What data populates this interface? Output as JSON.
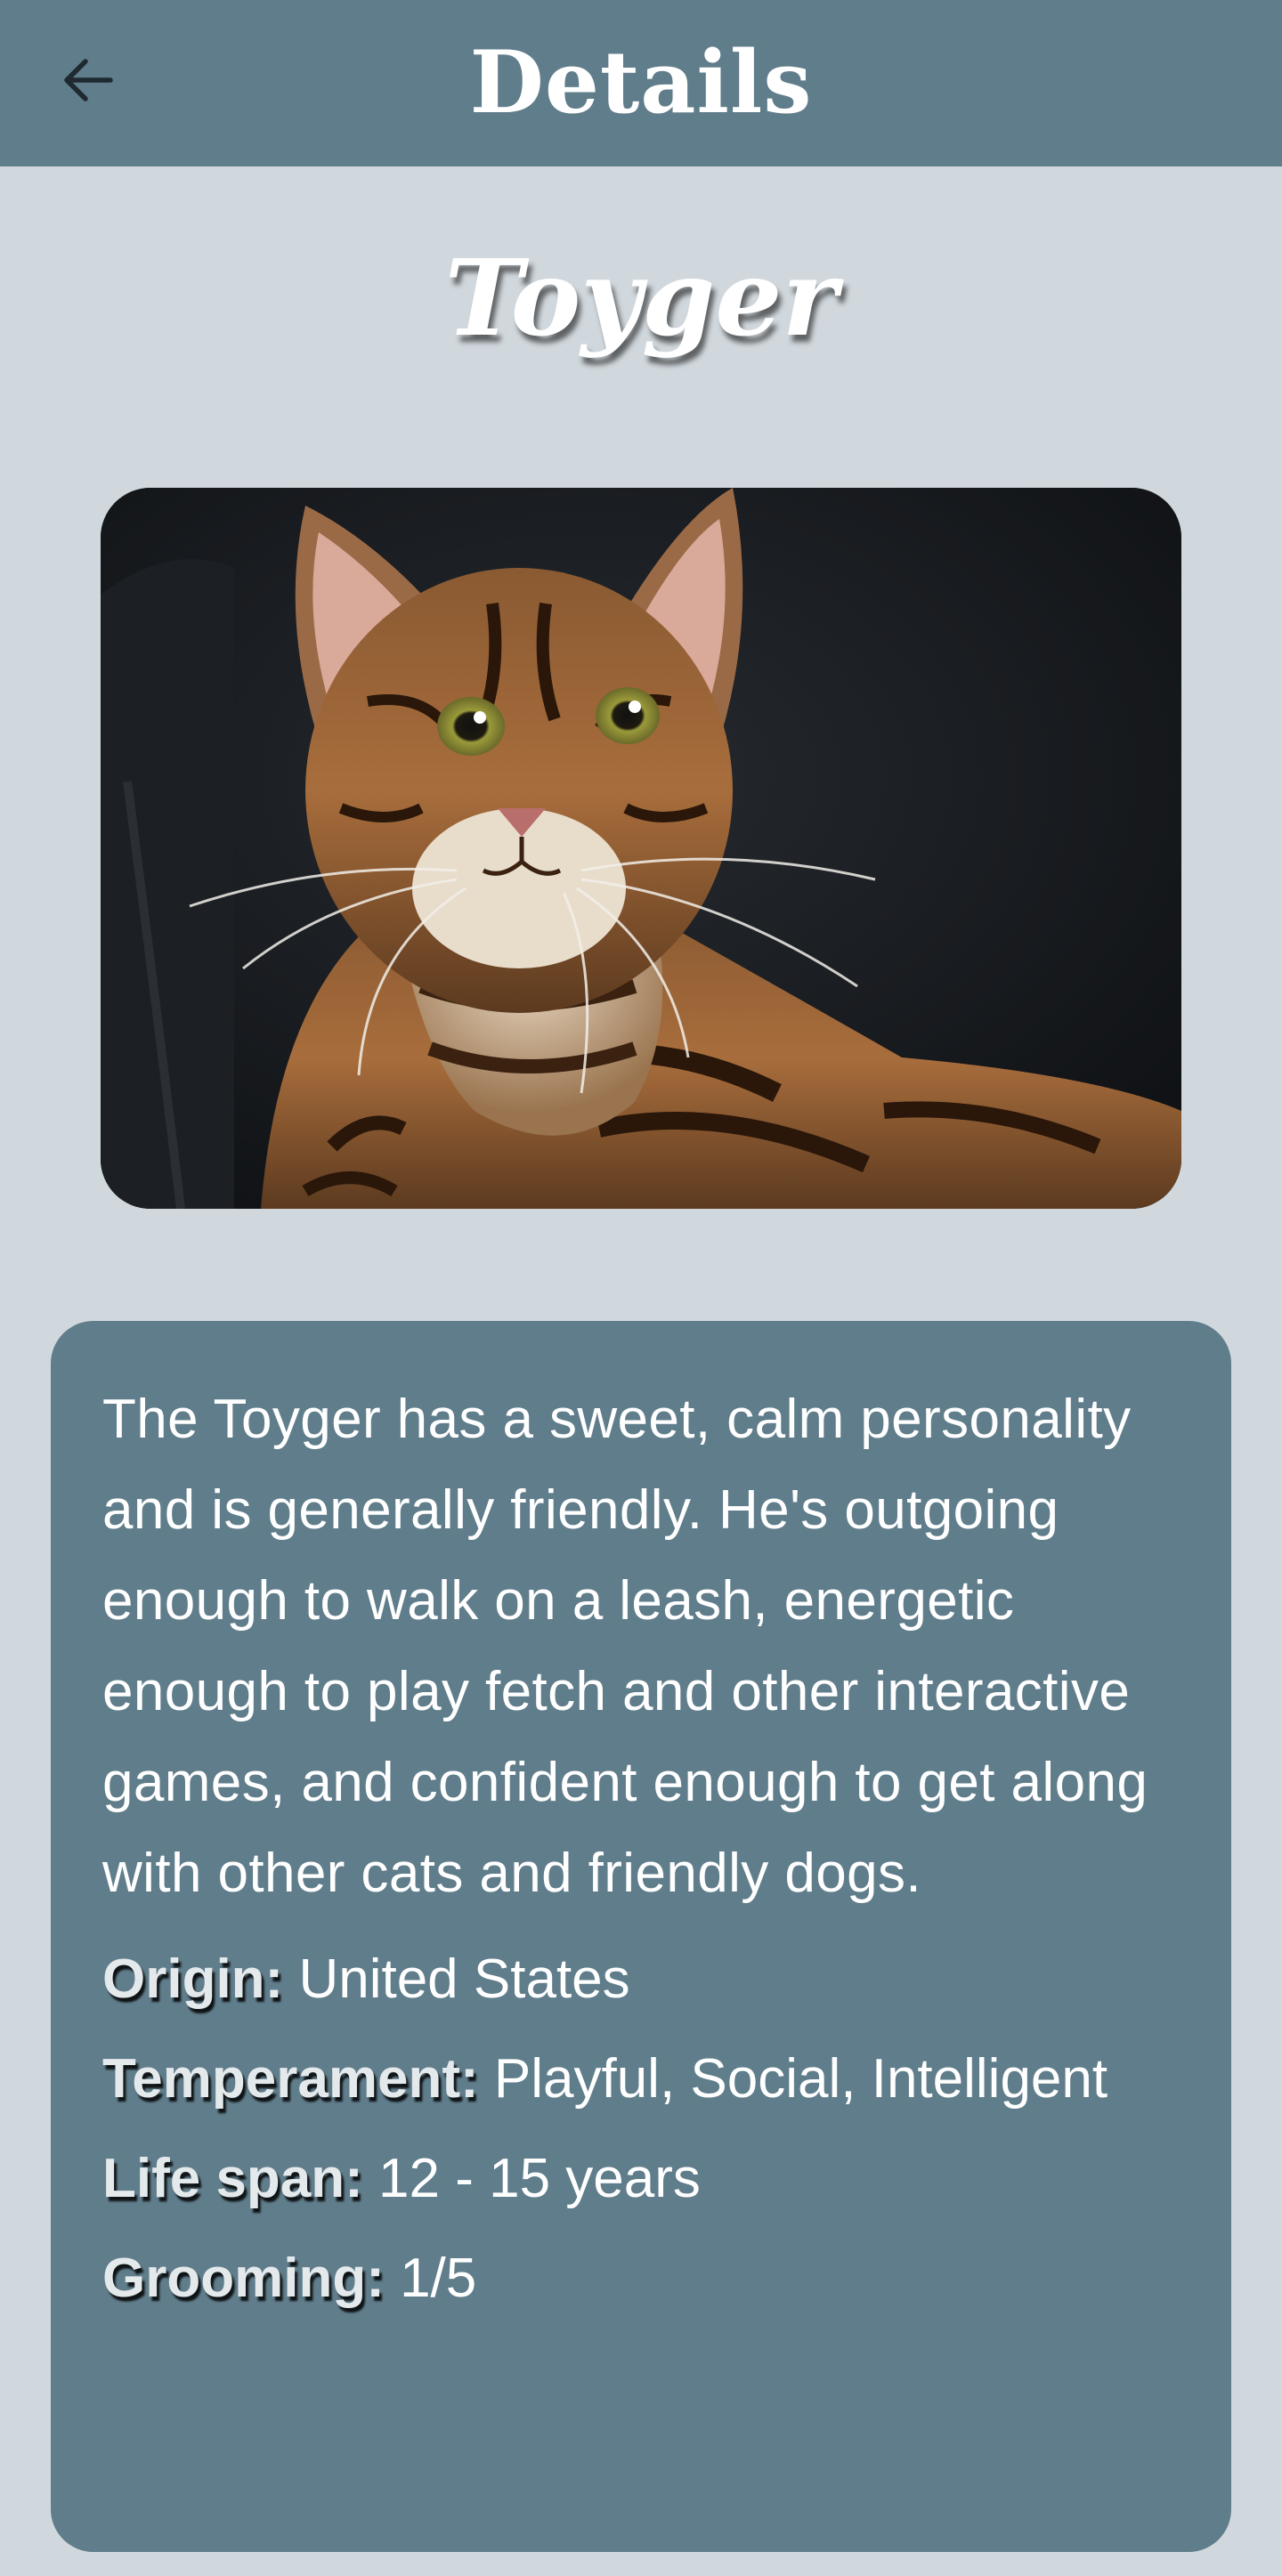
{
  "app_bar": {
    "title": "Details",
    "back_icon": "arrow-left-icon",
    "background": "#607d8b"
  },
  "breed": {
    "name": "Toyger",
    "image_alt": "toyger-cat-photo"
  },
  "info": {
    "description": "The Toyger has a sweet, calm personality and is generally friendly. He's outgoing enough to walk on a leash, energetic enough to play fetch and other interactive games, and confident enough to get along with other cats and friendly dogs.",
    "origin_label": "Origin:",
    "origin_value": "United States",
    "temperament_label": "Temperament:",
    "temperament_value": "Playful, Social, Intelligent",
    "life_span_label": "Life span:",
    "life_span_value": "12 - 15 years",
    "grooming_label": "Grooming:",
    "grooming_value": "1/5"
  },
  "colors": {
    "background": "#d1d8dd",
    "card": "#607d8b",
    "text": "#ffffff"
  }
}
